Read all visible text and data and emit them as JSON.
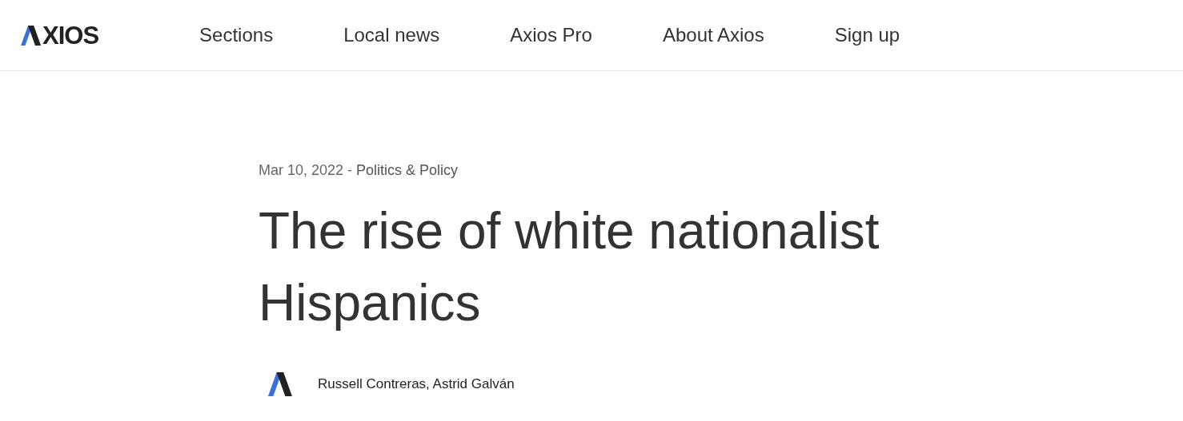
{
  "header": {
    "logo_text": "XIOS",
    "nav": [
      "Sections",
      "Local news",
      "Axios Pro",
      "About Axios",
      "Sign up"
    ]
  },
  "article": {
    "date": "Mar 10, 2022",
    "separator": "-",
    "category": "Politics & Policy",
    "headline": "The rise of white nationalist Hispanics",
    "authors": "Russell Contreras, Astrid Galván"
  }
}
